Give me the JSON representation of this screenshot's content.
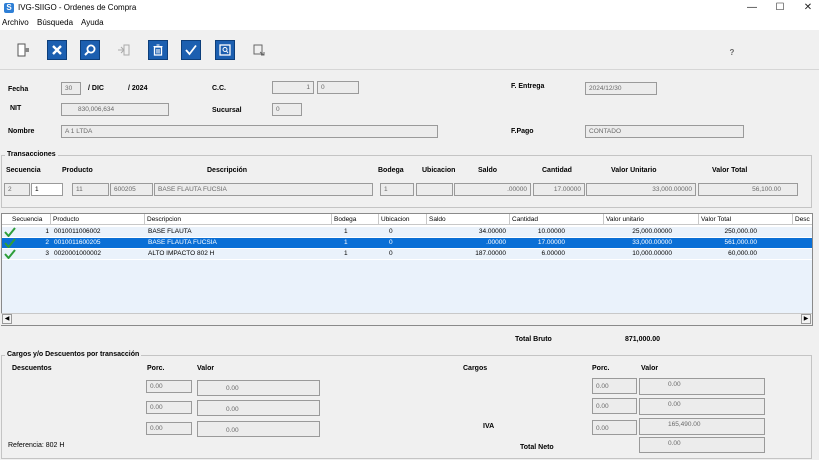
{
  "window": {
    "app_icon_letter": "S",
    "title": "IVG-SIIGO - Ordenes de Compra",
    "minimize": "—",
    "maximize": "☐",
    "close": "✕"
  },
  "menu": [
    "Archivo",
    "Búsqueda",
    "Ayuda"
  ],
  "toolbar": {
    "help_label": "?"
  },
  "header": {
    "fecha_label": "Fecha",
    "fecha_day": "30",
    "fecha_sep1": "/ DIC",
    "fecha_sep2": "/ 2024",
    "cc_label": "C.C.",
    "cc_value1": "1",
    "cc_value2": "0",
    "entrega_label": "F. Entrega",
    "entrega_value": "2024/12/30",
    "nit_label": "NIT",
    "nit_value": "830,006,634",
    "sucursal_label": "Sucursal",
    "sucursal_value": "0",
    "nombre_label": "Nombre",
    "nombre_value": "A 1 LTDA",
    "fpago_label": "F.Pago",
    "fpago_value": "CONTADO"
  },
  "transacciones": {
    "title": "Transacciones",
    "labels": {
      "secuencia": "Secuencia",
      "producto": "Producto",
      "descripcion": "Descripción",
      "bodega": "Bodega",
      "ubicacion": "Ubicacion",
      "saldo": "Saldo",
      "cantidad": "Cantidad",
      "valor_unitario": "Valor Unitario",
      "valor_total": "Valor Total"
    },
    "values": {
      "seq1": "2",
      "seq2": "1",
      "prod1": "11",
      "prod2": "600205",
      "descripcion": "BASE FLAUTA FUCSIA",
      "bodega": "1",
      "ubicacion": "",
      "saldo": ".00000",
      "cantidad": "17.00000",
      "valor_unitario": "33,000.00000",
      "valor_total": "56,100.00"
    }
  },
  "grid": {
    "columns": [
      "Secuencia",
      "Producto",
      "Descripcion",
      "Bodega",
      "Ubicacion",
      "Saldo",
      "Cantidad",
      "Valor unitario",
      "Valor Total",
      "Desc"
    ],
    "rows": [
      {
        "seq": "1",
        "producto": "0010011006002",
        "descripcion": "BASE FLAUTA",
        "bodega": "1",
        "ubicacion": "0",
        "saldo": "34.00000",
        "cantidad": "10.00000",
        "valor_unitario": "25,000.00000",
        "valor_total": "250,000.00"
      },
      {
        "seq": "2",
        "producto": "0010011600205",
        "descripcion": "BASE FLAUTA FUCSIA",
        "bodega": "1",
        "ubicacion": "0",
        "saldo": ".00000",
        "cantidad": "17.00000",
        "valor_unitario": "33,000.00000",
        "valor_total": "561,000.00"
      },
      {
        "seq": "3",
        "producto": "0020001000002",
        "descripcion": "ALTO IMPACTO 802 H",
        "bodega": "1",
        "ubicacion": "0",
        "saldo": "187.00000",
        "cantidad": "6.00000",
        "valor_unitario": "10,000.00000",
        "valor_total": "60,000.00"
      }
    ],
    "scroll_left": "◀",
    "scroll_right": "▶"
  },
  "totals": {
    "bruto_label": "Total Bruto",
    "bruto_value": "871,000.00",
    "neto_label": "Total Neto",
    "neto_value": "0.00"
  },
  "cargos": {
    "title": "Cargos y/o Descuentos por transacción",
    "descuentos_label": "Descuentos",
    "porc_label": "Porc.",
    "valor_label": "Valor",
    "cargos_label": "Cargos",
    "iva_label": "IVA",
    "desc_rows": [
      {
        "porc": "0.00",
        "valor": "0.00"
      },
      {
        "porc": "0.00",
        "valor": "0.00"
      },
      {
        "porc": "0.00",
        "valor": "0.00"
      }
    ],
    "cargo_rows": [
      {
        "porc": "0.00",
        "valor": "0.00"
      },
      {
        "porc": "0.00",
        "valor": "0.00"
      },
      {
        "porc": "0.00",
        "valor": "165,490.00"
      }
    ],
    "referencia": "Referencia: 802 H"
  },
  "colors": {
    "selection": "#0a6fd6",
    "toolbar_blue": "#1c5fb0",
    "check_green": "#2e9e3a"
  }
}
